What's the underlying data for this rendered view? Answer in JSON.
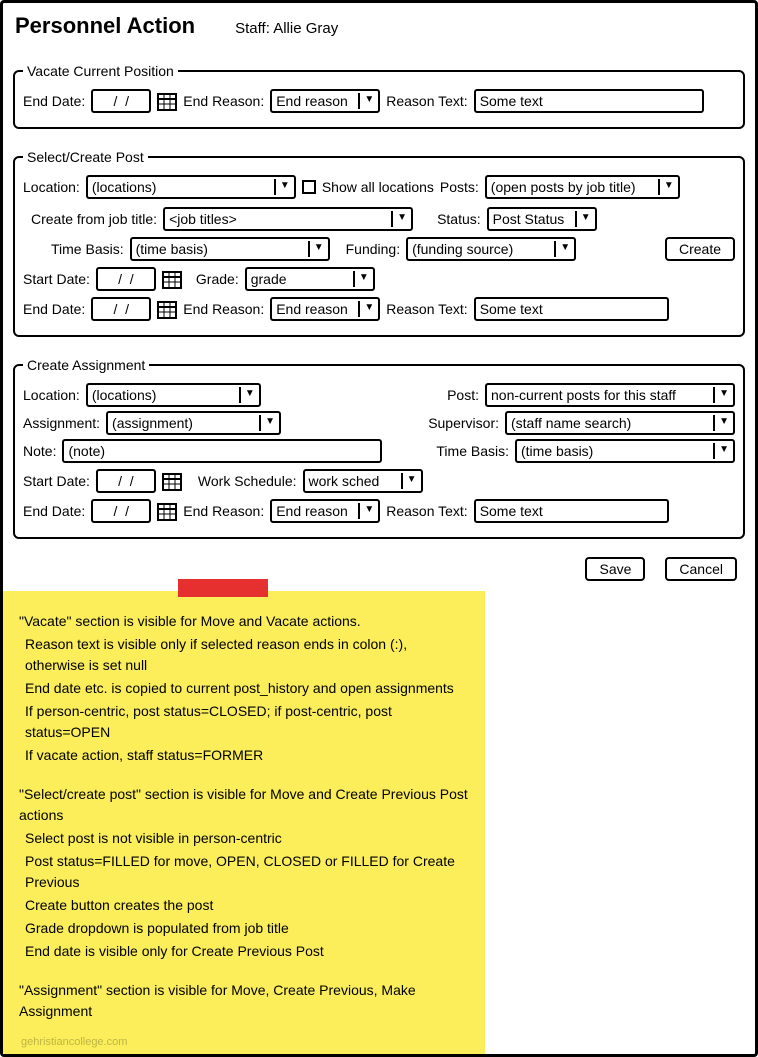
{
  "header": {
    "title": "Personnel Action",
    "staff": "Staff: Allie Gray"
  },
  "vacate": {
    "legend": "Vacate Current Position",
    "endDateLabel": "End Date:",
    "endDateValue": "/  /",
    "endReasonLabel": "End Reason:",
    "endReasonValue": "End reason",
    "reasonTextLabel": "Reason Text:",
    "reasonTextValue": "Some text"
  },
  "selectPost": {
    "legend": "Select/Create Post",
    "locationLabel": "Location:",
    "locationValue": "(locations)",
    "showAllLabel": "Show all locations",
    "postsLabel": "Posts:",
    "postsValue": "(open posts by job title)",
    "jobTitleLabel": "Create from job title:",
    "jobTitleValue": "<job titles>",
    "statusLabel": "Status:",
    "statusValue": "Post Status",
    "timeBasisLabel": "Time Basis:",
    "timeBasisValue": "(time basis)",
    "fundingLabel": "Funding:",
    "fundingValue": "(funding source)",
    "createBtn": "Create",
    "startDateLabel": "Start Date:",
    "startDateValue": "/  /",
    "gradeLabel": "Grade:",
    "gradeValue": "grade",
    "endDateLabel": "End Date:",
    "endDateValue": "/  /",
    "endReasonLabel": "End Reason:",
    "endReasonValue": "End reason",
    "reasonTextLabel": "Reason Text:",
    "reasonTextValue": "Some text"
  },
  "assignment": {
    "legend": "Create Assignment",
    "locationLabel": "Location:",
    "locationValue": "(locations)",
    "postLabel": "Post:",
    "postValue": "non-current posts for this staff",
    "assignmentLabel": "Assignment:",
    "assignmentValue": "(assignment)",
    "supervisorLabel": "Supervisor:",
    "supervisorValue": "(staff name search)",
    "noteLabel": "Note:",
    "noteValue": "(note)",
    "timeBasisLabel": "Time Basis:",
    "timeBasisValue": "(time basis)",
    "startDateLabel": "Start Date:",
    "startDateValue": "/  /",
    "workSchedLabel": "Work Schedule:",
    "workSchedValue": "work sched",
    "endDateLabel": "End Date:",
    "endDateValue": "/  /",
    "endReasonLabel": "End Reason:",
    "endReasonValue": "End reason",
    "reasonTextLabel": "Reason Text:",
    "reasonTextValue": "Some text"
  },
  "actions": {
    "save": "Save",
    "cancel": "Cancel"
  },
  "note": {
    "l1": "\"Vacate\" section is visible for Move and Vacate actions.",
    "l2": "Reason text is visible only if selected reason ends in colon (:), otherwise is set null",
    "l3": "End date etc. is copied to current post_history and open assignments",
    "l4": "If person-centric, post status=CLOSED; if post-centric, post status=OPEN",
    "l5": "If vacate action, staff status=FORMER",
    "l6": "\"Select/create post\" section is visible for Move and Create Previous Post actions",
    "l7": "Select post is not visible in person-centric",
    "l8": "Post status=FILLED for move, OPEN, CLOSED or FILLED for Create Previous",
    "l9": "Create button creates the post",
    "l10": "Grade dropdown is populated from job title",
    "l11": "End date is visible only for Create Previous Post",
    "l12": "\"Assignment\" section is visible for Move, Create Previous, Make Assignment"
  },
  "watermark": "gehristiancollege.com"
}
